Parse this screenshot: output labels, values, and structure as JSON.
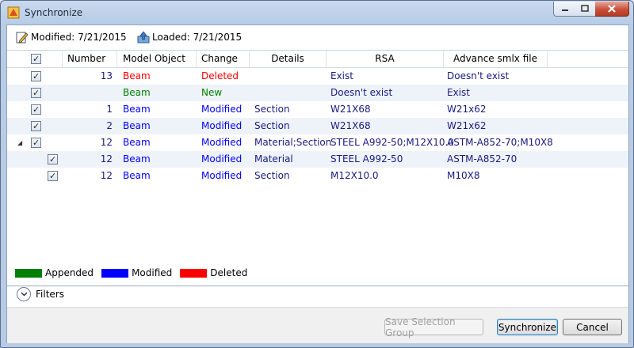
{
  "window": {
    "title": "Synchronize",
    "icon": "app-icon"
  },
  "info": {
    "modified": "Modified: 7/21/2015",
    "loaded": "Loaded: 7/21/2015"
  },
  "columns": [
    "Number",
    "Model Object",
    "Change",
    "Details",
    "RSA",
    "Advance smlx file"
  ],
  "rows": [
    {
      "checked": true,
      "number": "13",
      "object": "Beam",
      "change": "Deleted",
      "details": "",
      "rsa": "Exist",
      "smlx": "Doesn't exist",
      "status": "deleted"
    },
    {
      "checked": true,
      "number": "",
      "object": "Beam",
      "change": "New",
      "details": "",
      "rsa": "Doesn't exist",
      "smlx": "Exist",
      "status": "appended"
    },
    {
      "checked": true,
      "number": "1",
      "object": "Beam",
      "change": "Modified",
      "details": "Section",
      "rsa": "W21X68",
      "smlx": "W21x62",
      "status": "modified"
    },
    {
      "checked": true,
      "number": "2",
      "object": "Beam",
      "change": "Modified",
      "details": "Section",
      "rsa": "W21X68",
      "smlx": "W21x62",
      "status": "modified"
    },
    {
      "checked": true,
      "number": "12",
      "object": "Beam",
      "change": "Modified",
      "details": "Material;Section",
      "rsa": "STEEL A992-50;M12X10.0",
      "smlx": "ASTM-A852-70;M10X8",
      "status": "modified",
      "expanded": true
    },
    {
      "checked": true,
      "number": "12",
      "object": "Beam",
      "change": "Modified",
      "details": "Material",
      "rsa": "STEEL A992-50",
      "smlx": "ASTM-A852-70",
      "status": "modified",
      "child": true
    },
    {
      "checked": true,
      "number": "12",
      "object": "Beam",
      "change": "Modified",
      "details": "Section",
      "rsa": "M12X10.0",
      "smlx": "M10X8",
      "status": "modified",
      "child": true
    }
  ],
  "colors": {
    "appended": "#008000",
    "modified": "#0000ff",
    "deleted": "#ff0000",
    "text_blue": "#1a1a80"
  },
  "legend": {
    "appended": "Appended",
    "modified": "Modified",
    "deleted": "Deleted"
  },
  "filters": {
    "label": "Filters"
  },
  "buttons": {
    "save_group": "Save Selection Group",
    "synchronize": "Synchronize",
    "cancel": "Cancel"
  }
}
